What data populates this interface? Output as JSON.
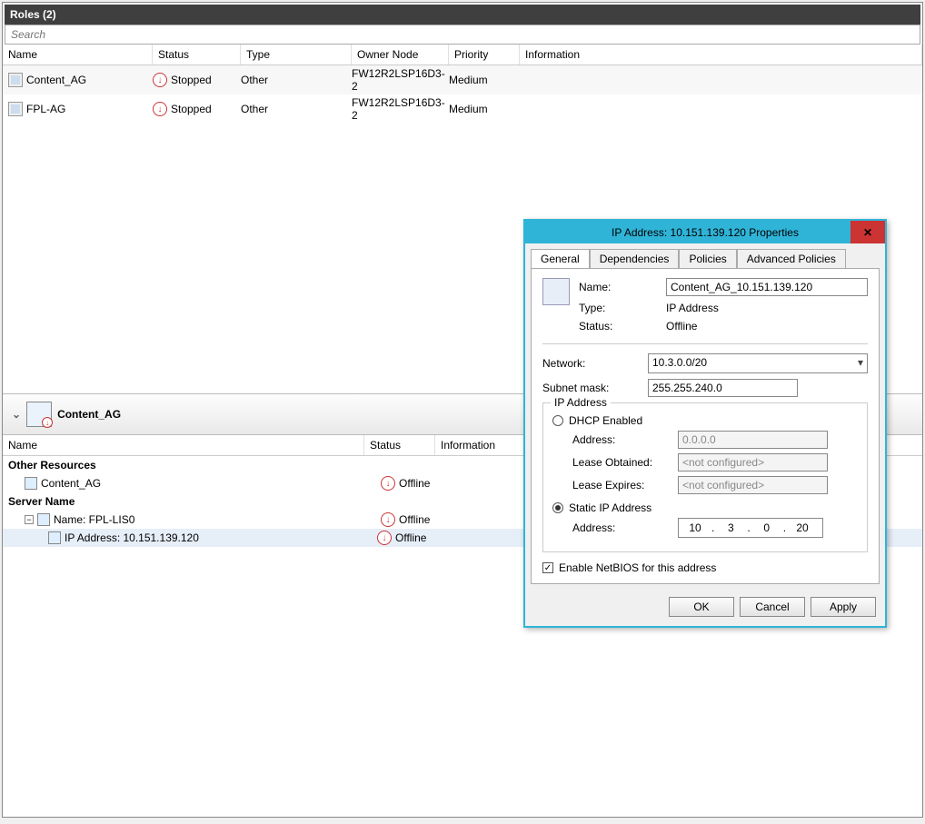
{
  "header": {
    "title": "Roles (2)",
    "search_placeholder": "Search"
  },
  "columns": {
    "name": "Name",
    "status": "Status",
    "type": "Type",
    "owner": "Owner Node",
    "priority": "Priority",
    "info": "Information"
  },
  "roles": [
    {
      "name": "Content_AG",
      "status": "Stopped",
      "type": "Other",
      "owner": "FW12R2LSP16D3-2",
      "priority": "Medium"
    },
    {
      "name": "FPL-AG",
      "status": "Stopped",
      "type": "Other",
      "owner": "FW12R2LSP16D3-2",
      "priority": "Medium"
    }
  ],
  "detail": {
    "selected_role": "Content_AG",
    "columns": {
      "name": "Name",
      "status": "Status",
      "info": "Information"
    },
    "groups": {
      "other_resources": "Other Resources",
      "server_name": "Server Name"
    },
    "other_resources": [
      {
        "name": "Content_AG",
        "status": "Offline"
      }
    ],
    "server_name_node": {
      "label": "Name: FPL-LIS0",
      "status": "Offline"
    },
    "ip_node": {
      "label": "IP Address: 10.151.139.120",
      "status": "Offline"
    }
  },
  "dialog": {
    "title": "IP Address: 10.151.139.120 Properties",
    "tabs": {
      "general": "General",
      "dependencies": "Dependencies",
      "policies": "Policies",
      "advanced": "Advanced Policies"
    },
    "labels": {
      "name": "Name:",
      "type": "Type:",
      "status": "Status:",
      "network": "Network:",
      "subnet": "Subnet mask:",
      "ip_group": "IP Address",
      "dhcp": "DHCP Enabled",
      "address": "Address:",
      "lease_obtained": "Lease Obtained:",
      "lease_expires": "Lease Expires:",
      "static": "Static IP Address",
      "netbios": "Enable NetBIOS for this address"
    },
    "values": {
      "name": "Content_AG_10.151.139.120",
      "type": "IP Address",
      "status": "Offline",
      "network": "10.3.0.0/20",
      "subnet": "255.255.240.0",
      "dhcp_address": "0.0.0.0",
      "lease_obtained": "<not configured>",
      "lease_expires": "<not configured>",
      "static_ip": {
        "a": "10",
        "b": "3",
        "c": "0",
        "d": "20"
      },
      "netbios_checked": true
    },
    "buttons": {
      "ok": "OK",
      "cancel": "Cancel",
      "apply": "Apply"
    }
  }
}
